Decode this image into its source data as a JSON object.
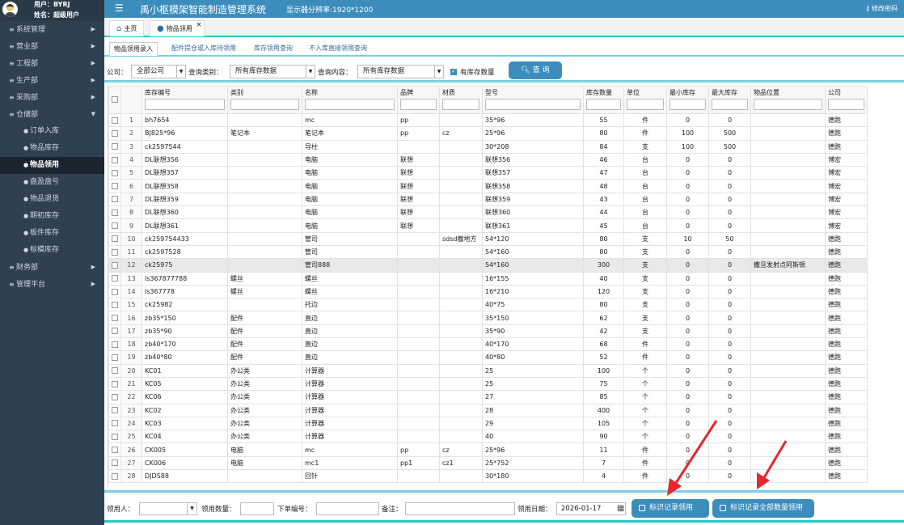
{
  "user": {
    "line1": "用户：BYRJ",
    "line2": "姓名：超级用户"
  },
  "sidebar": {
    "items": [
      {
        "label": "系统管理",
        "arrow": "▶"
      },
      {
        "label": "营业部",
        "arrow": "▶"
      },
      {
        "label": "工程部",
        "arrow": "▶"
      },
      {
        "label": "生产部",
        "arrow": "▶"
      },
      {
        "label": "采购部",
        "arrow": "▶"
      },
      {
        "label": "仓储部",
        "arrow": "▼"
      }
    ],
    "sub_items": [
      {
        "label": "订单入库"
      },
      {
        "label": "物品库存"
      },
      {
        "label": "物品领用"
      },
      {
        "label": "盘盈盘亏"
      },
      {
        "label": "物品退货"
      },
      {
        "label": "期初库存"
      },
      {
        "label": "板件库存"
      },
      {
        "label": "标模库存"
      }
    ],
    "items_after": [
      {
        "label": "财务部",
        "arrow": "▶"
      },
      {
        "label": "管理平台",
        "arrow": "▶"
      }
    ]
  },
  "header": {
    "title": "禹小枢模架智能制造管理系统",
    "resolution": "显示器分辨率:1920*1200",
    "change_password": "修改密码"
  },
  "tabs": {
    "home": "主页",
    "items": "物品领用"
  },
  "subtabs": [
    "物品领用录入",
    "配件提仓或入库待领用",
    "库存领用查询",
    "不入库直接领用查询"
  ],
  "filters": {
    "company_label": "公司：",
    "company_value": "全部公司",
    "query_type_label": "查询类别：",
    "query_type_value": "所有库存数据",
    "query_content_label": "查询内容：",
    "query_content_value": "所有库存数据",
    "has_stock_label": "有库存数量",
    "query_button": "查 询"
  },
  "table": {
    "columns": [
      "库存编号",
      "类别",
      "名称",
      "品牌",
      "材质",
      "型号",
      "库存数量",
      "单位",
      "最小库存",
      "最大库存",
      "物品位置",
      "公司"
    ],
    "rows": [
      [
        "1",
        "bh7654",
        "",
        "mc",
        "pp",
        "",
        "35*96",
        "55",
        "件",
        "0",
        "0",
        "",
        "德跑"
      ],
      [
        "2",
        "BJ825*96",
        "笔记本",
        "笔记本",
        "pp",
        "cz",
        "25*96",
        "80",
        "件",
        "100",
        "500",
        "",
        "德跑"
      ],
      [
        "3",
        "ck2597544",
        "",
        "导柱",
        "",
        "",
        "30*208",
        "84",
        "支",
        "100",
        "500",
        "",
        "德跑"
      ],
      [
        "4",
        "DL联想356",
        "",
        "电脑",
        "联想",
        "",
        "联想356",
        "46",
        "台",
        "0",
        "0",
        "",
        "博宏"
      ],
      [
        "5",
        "DL联想357",
        "",
        "电脑",
        "联想",
        "",
        "联想357",
        "47",
        "台",
        "0",
        "0",
        "",
        "博宏"
      ],
      [
        "6",
        "DL联想358",
        "",
        "电脑",
        "联想",
        "",
        "联想358",
        "48",
        "台",
        "0",
        "0",
        "",
        "博宏"
      ],
      [
        "7",
        "DL联想359",
        "",
        "电脑",
        "联想",
        "",
        "联想359",
        "43",
        "台",
        "0",
        "0",
        "",
        "博宏"
      ],
      [
        "8",
        "DL联想360",
        "",
        "电脑",
        "联想",
        "",
        "联想360",
        "44",
        "台",
        "0",
        "0",
        "",
        "博宏"
      ],
      [
        "9",
        "DL联想361",
        "",
        "电脑",
        "联想",
        "",
        "联想361",
        "45",
        "台",
        "0",
        "0",
        "",
        "博宏"
      ],
      [
        "10",
        "ck259754433",
        "",
        "管司",
        "",
        "sdsd撒地方",
        "54*120",
        "80",
        "支",
        "10",
        "50",
        "",
        "德跑"
      ],
      [
        "11",
        "ck2597528",
        "",
        "管司",
        "",
        "",
        "54*160",
        "80",
        "支",
        "0",
        "0",
        "",
        "德跑"
      ],
      [
        "12",
        "ck25975",
        "",
        "管司888",
        "",
        "",
        "54*160",
        "300",
        "支",
        "0",
        "0",
        "撒旦发射点阿斯顿",
        "德跑"
      ],
      [
        "13",
        "ls367877788",
        "螺丝",
        "螺丝",
        "",
        "",
        "16*155",
        "40",
        "支",
        "0",
        "0",
        "",
        "德跑"
      ],
      [
        "14",
        "ls367778",
        "螺丝",
        "螺丝",
        "",
        "",
        "16*210",
        "120",
        "支",
        "0",
        "0",
        "",
        "德跑"
      ],
      [
        "15",
        "ck25982",
        "",
        "托边",
        "",
        "",
        "40*75",
        "80",
        "支",
        "0",
        "0",
        "",
        "德跑"
      ],
      [
        "16",
        "zb35*150",
        "配件",
        "直边",
        "",
        "",
        "35*150",
        "62",
        "支",
        "0",
        "0",
        "",
        "德跑"
      ],
      [
        "17",
        "zb35*90",
        "配件",
        "直边",
        "",
        "",
        "35*90",
        "42",
        "支",
        "0",
        "0",
        "",
        "德跑"
      ],
      [
        "18",
        "zb40*170",
        "配件",
        "直边",
        "",
        "",
        "40*170",
        "68",
        "件",
        "0",
        "0",
        "",
        "德跑"
      ],
      [
        "19",
        "zb40*80",
        "配件",
        "直边",
        "",
        "",
        "40*80",
        "52",
        "件",
        "0",
        "0",
        "",
        "德跑"
      ],
      [
        "20",
        "KC01",
        "办公类",
        "计算器",
        "",
        "",
        "25",
        "100",
        "个",
        "0",
        "0",
        "",
        "德跑"
      ],
      [
        "21",
        "KC05",
        "办公类",
        "计算器",
        "",
        "",
        "25",
        "75",
        "个",
        "0",
        "0",
        "",
        "德跑"
      ],
      [
        "22",
        "KC06",
        "办公类",
        "计算器",
        "",
        "",
        "27",
        "85",
        "个",
        "0",
        "0",
        "",
        "德跑"
      ],
      [
        "23",
        "KC02",
        "办公类",
        "计算器",
        "",
        "",
        "28",
        "400",
        "个",
        "0",
        "0",
        "",
        "德跑"
      ],
      [
        "24",
        "KC03",
        "办公类",
        "计算器",
        "",
        "",
        "29",
        "105",
        "个",
        "0",
        "0",
        "",
        "德跑"
      ],
      [
        "25",
        "KC04",
        "办公类",
        "计算器",
        "",
        "",
        "40",
        "90",
        "个",
        "0",
        "0",
        "",
        "德跑"
      ],
      [
        "26",
        "CK005",
        "电脑",
        "mc",
        "pp",
        "cz",
        "25*96",
        "11",
        "件",
        "0",
        "0",
        "",
        "德跑"
      ],
      [
        "27",
        "CK006",
        "电脑",
        "mc1",
        "pp1",
        "cz1",
        "25*752",
        "7",
        "件",
        "0",
        "0",
        "",
        "德跑"
      ],
      [
        "28",
        "DJDS88",
        "",
        "回针",
        "",
        "",
        "30*180",
        "4",
        "件",
        "0",
        "0",
        "",
        "德跑"
      ]
    ]
  },
  "bottom": {
    "requester_label": "领用人：",
    "qty_label": "领用数量：",
    "order_no_label": "下单编号：",
    "remark_label": "备注：",
    "date_label": "领用日期：",
    "date_value": "2026-01-17",
    "btn_mark": "标识记录领用",
    "btn_mark_all": "标识记录全部数量领用"
  },
  "colors": {
    "header": "#3c8dbc",
    "sidebar": "#2f4050",
    "accent": "#2fc6c6",
    "arrow": "#e8262d"
  }
}
